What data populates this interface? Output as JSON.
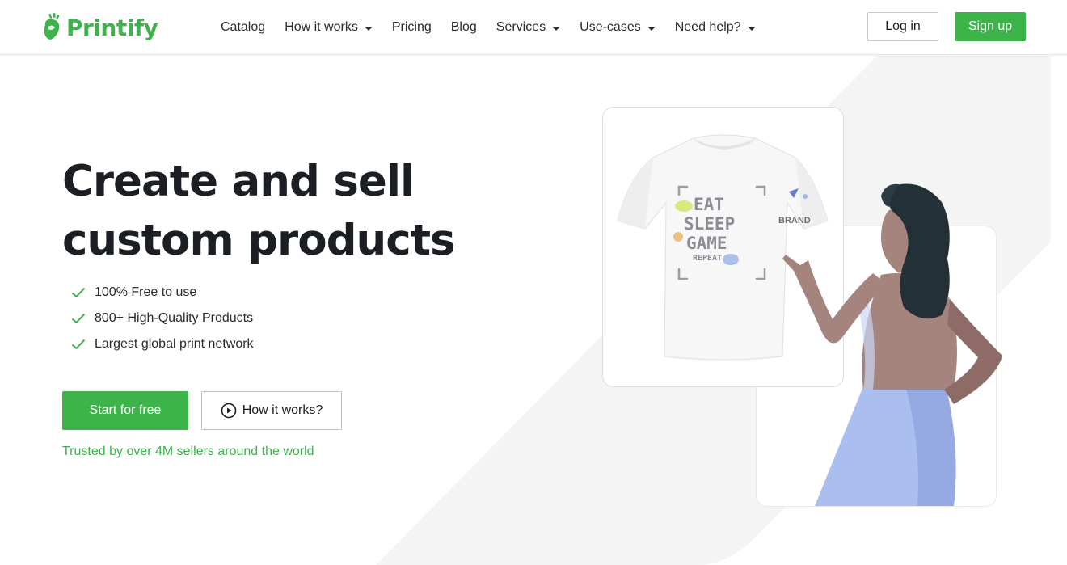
{
  "header": {
    "logo_text": "Printify",
    "nav": [
      {
        "label": "Catalog",
        "has_dropdown": false
      },
      {
        "label": "How it works",
        "has_dropdown": true
      },
      {
        "label": "Pricing",
        "has_dropdown": false
      },
      {
        "label": "Blog",
        "has_dropdown": false
      },
      {
        "label": "Services",
        "has_dropdown": true
      },
      {
        "label": "Use-cases",
        "has_dropdown": true
      },
      {
        "label": "Need help?",
        "has_dropdown": true
      }
    ],
    "login_label": "Log in",
    "signup_label": "Sign up"
  },
  "hero": {
    "title_line1": "Create and sell",
    "title_line2": "custom products",
    "features": [
      "100% Free to use",
      "800+ High-Quality Products",
      "Largest global print network"
    ],
    "start_label": "Start for free",
    "how_label": "How it works?",
    "trusted_text": "Trusted by over 4M sellers around the world"
  },
  "illustration": {
    "shirt_design": [
      "EAT",
      "SLEEP",
      "GAME",
      "REPEAT"
    ],
    "brand_label": "BRAND"
  },
  "colors": {
    "brand_green": "#3cb44a",
    "text_dark": "#1b1f23",
    "bg_shape": "#f4f4f4"
  },
  "icons": {
    "logo": "printify-logo-icon",
    "check": "checkmark-icon",
    "play": "play-circle-icon",
    "dropdown": "caret-down-icon"
  }
}
